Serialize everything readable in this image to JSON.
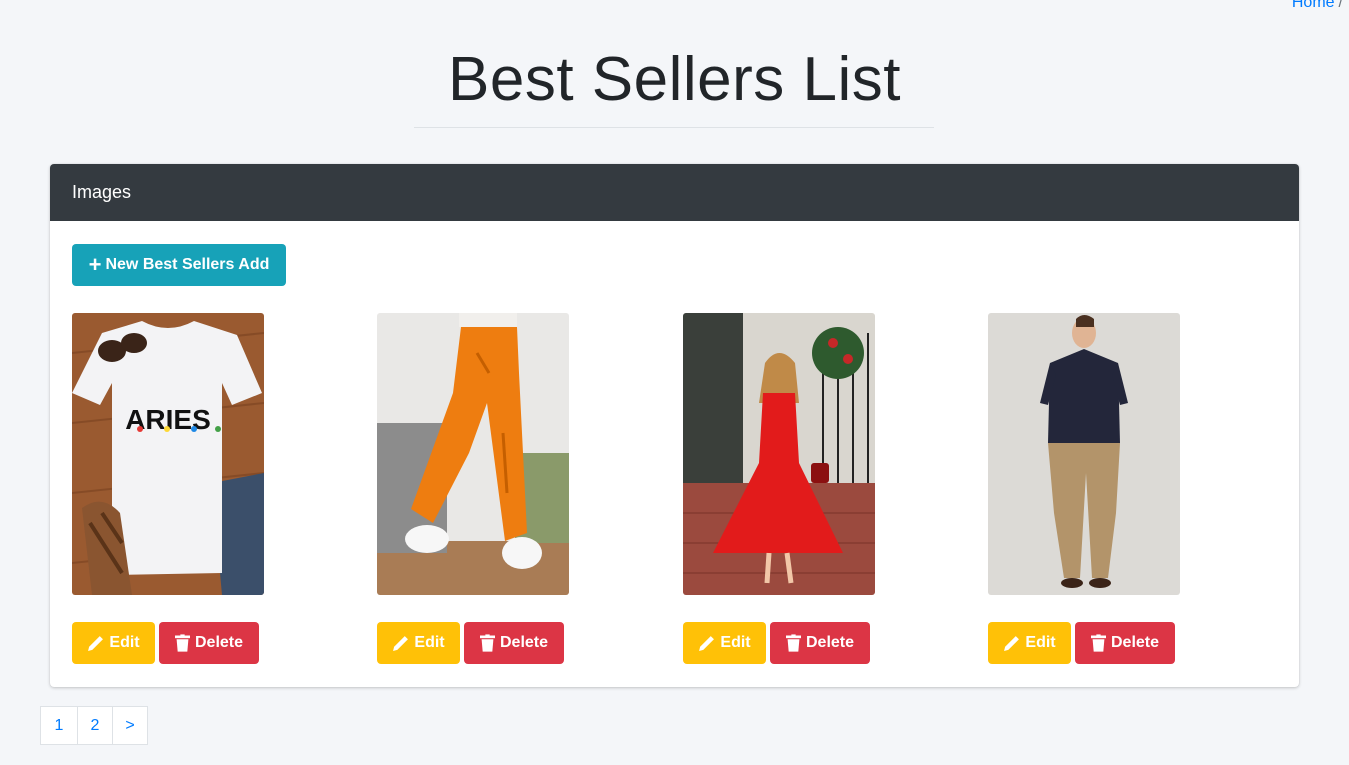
{
  "breadcrumb": {
    "home": "Home",
    "separator": "/"
  },
  "page": {
    "title": "Best Sellers List"
  },
  "card": {
    "header": "Images",
    "add_button": "New Best Sellers Add",
    "items": [
      {
        "image": "white-aries-tshirt",
        "edit_label": "Edit",
        "delete_label": "Delete"
      },
      {
        "image": "orange-cargo-pants",
        "edit_label": "Edit",
        "delete_label": "Delete"
      },
      {
        "image": "red-dress",
        "edit_label": "Edit",
        "delete_label": "Delete"
      },
      {
        "image": "navy-polo-khaki-pants",
        "edit_label": "Edit",
        "delete_label": "Delete"
      }
    ],
    "tshirt_text": "ARIES"
  },
  "pagination": {
    "pages": [
      "1",
      "2",
      ">"
    ]
  },
  "colors": {
    "background": "#f4f6f9",
    "header": "#343a40",
    "add": "#17a2b8",
    "edit": "#ffc107",
    "delete": "#dc3545",
    "link": "#007bff"
  }
}
